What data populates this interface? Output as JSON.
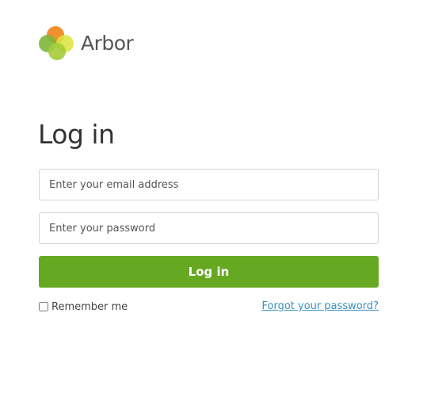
{
  "brand": {
    "name": "Arbor",
    "logo_colors": [
      "#f08a24",
      "#8cc63f",
      "#d4e157",
      "#a4cc3a"
    ]
  },
  "page": {
    "title": "Log in"
  },
  "form": {
    "email_placeholder": "Enter your email address",
    "password_placeholder": "Enter your password",
    "submit_label": "Log in",
    "remember_label": "Remember me",
    "remember_checked": false,
    "forgot_link": "Forgot your password?"
  },
  "colors": {
    "primary_button": "#67a823",
    "link": "#3a8fbf"
  }
}
